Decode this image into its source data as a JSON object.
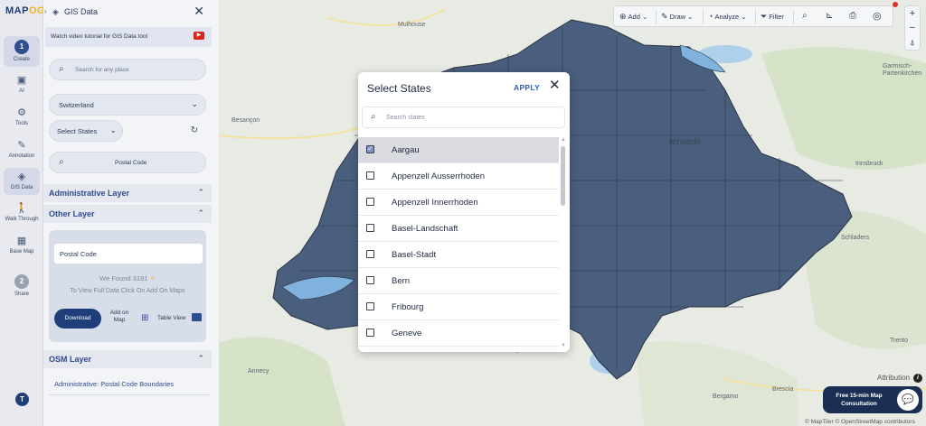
{
  "rail": {
    "logo_main": "MAP",
    "logo_accent": "OG",
    "items": [
      {
        "step": "1",
        "label": "Create"
      },
      {
        "label": "AI",
        "icon": "ai-icon"
      },
      {
        "label": "Tools",
        "icon": "gear-icon"
      },
      {
        "label": "Annotation",
        "icon": "annotation-icon"
      },
      {
        "label": "GIS Data",
        "icon": "layers-icon"
      },
      {
        "label": "Walk Through",
        "icon": "walk-icon"
      },
      {
        "label": "Base Map",
        "icon": "basemap-icon"
      },
      {
        "step": "2",
        "label": "Share"
      }
    ],
    "avatar": "T"
  },
  "panel": {
    "title": "GIS Data",
    "tutorial": "Watch video tutorial for GIS Data tool",
    "search_placeholder": "Search for any place",
    "country": "Switzerland",
    "states_label": "Select States",
    "postal_code": "Postal Code",
    "admin_layer": "Administrative Layer",
    "other_layer": "Other Layer",
    "field_value": "Postal Code",
    "found_prefix": "We Found",
    "found_count": "3181",
    "hint": "To View Full Data Click On Add On Maps",
    "download": "Download",
    "add_on_map_1": "Add on",
    "add_on_map_2": "Map",
    "table_view": "Table View",
    "osm_layer": "OSM Layer",
    "osm_item": "Administrative: Postal Code Boundaries"
  },
  "toolbar": {
    "add": "Add",
    "draw": "Draw",
    "analyze": "Analyze",
    "filter": "Filter"
  },
  "map": {
    "places": [
      {
        "name": "Mulhouse"
      },
      {
        "name": "Besançon"
      },
      {
        "name": "tenstein",
        "big": true
      },
      {
        "name": "Garmisch-Partenkirchen"
      },
      {
        "name": "Innsbruck"
      },
      {
        "name": "Schladers"
      },
      {
        "name": "Trento"
      },
      {
        "name": "Annecy"
      },
      {
        "name": "Bergamo"
      },
      {
        "name": "Brescia"
      }
    ],
    "attribution": "Attribution",
    "copyright": "© MapTiler © OpenStreetMap contributors",
    "consult_line1": "Free 15-min Map",
    "consult_line2": "Consultation"
  },
  "modal": {
    "title": "Select States",
    "apply": "APPLY",
    "search_placeholder": "Search states",
    "states": [
      {
        "name": "Aargau",
        "checked": true
      },
      {
        "name": "Appenzell Ausserrhoden",
        "checked": false
      },
      {
        "name": "Appenzell Innerrhoden",
        "checked": false
      },
      {
        "name": "Basel-Landschaft",
        "checked": false
      },
      {
        "name": "Basel-Stadt",
        "checked": false
      },
      {
        "name": "Bern",
        "checked": false
      },
      {
        "name": "Fribourg",
        "checked": false
      },
      {
        "name": "Geneve",
        "checked": false
      }
    ]
  },
  "colors": {
    "brand": "#1d3b77",
    "accent": "#f0b323",
    "region_fill": "#4a5f7d",
    "apply": "#2f5cb3"
  }
}
